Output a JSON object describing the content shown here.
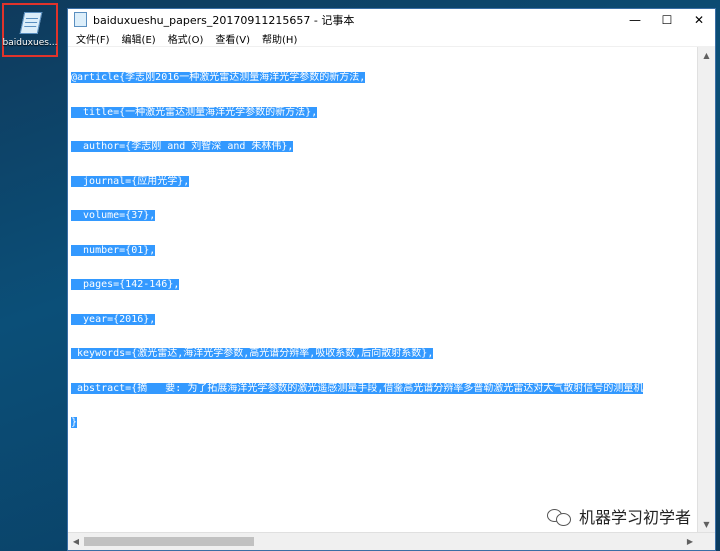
{
  "desktop": {
    "icon_label": "baiduxues..."
  },
  "window": {
    "title": "baiduxueshu_papers_20170911215657 - 记事本",
    "controls": {
      "minimize": "—",
      "maximize": "☐",
      "close": "✕"
    }
  },
  "menu": [
    {
      "label": "文件(F)"
    },
    {
      "label": "编辑(E)"
    },
    {
      "label": "格式(O)"
    },
    {
      "label": "查看(V)"
    },
    {
      "label": "帮助(H)"
    }
  ],
  "editor": {
    "lines": [
      "@article{李志刚2016一种激光雷达测量海洋光学参数的新方法,",
      "  title={一种激光雷达测量海洋光学参数的新方法},",
      "  author={李志刚 and 刘智深 and 朱林伟},",
      "  journal={应用光学},",
      "  volume={37},",
      "  number={01},",
      "  pages={142-146},",
      "  year={2016},",
      " keywords={激光雷达,海洋光学参数,高光谱分辨率,吸收系数,后向散射系数},",
      " abstract={摘   要: 为了拓展海洋光学参数的激光遥感测量手段,借鉴高光谱分辨率多普勒激光雷达对大气散射信号的测量机",
      "}"
    ]
  },
  "watermark": {
    "text": "机器学习初学者"
  }
}
